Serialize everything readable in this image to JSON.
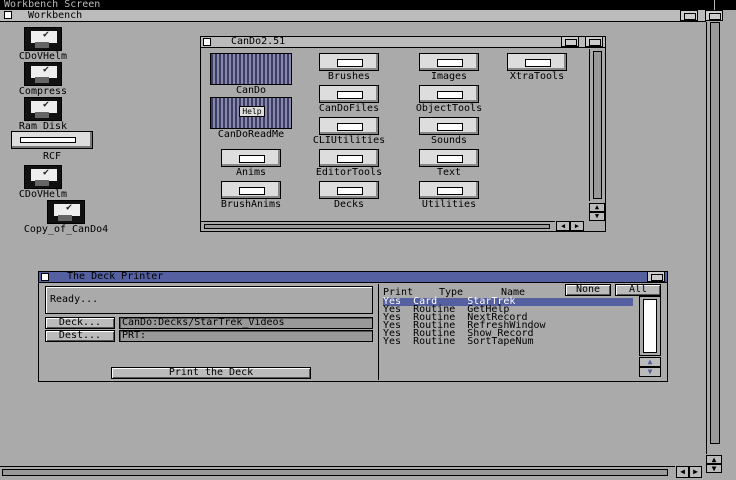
{
  "screen": {
    "title": "Workbench Screen"
  },
  "workbench": {
    "title": "Workbench"
  },
  "desktop_icons": [
    {
      "label": "CDoVHelm"
    },
    {
      "label": "Compress"
    },
    {
      "label": "Ram Disk"
    },
    {
      "label": "RCF"
    },
    {
      "label": "CDoVHelm"
    },
    {
      "label": "Copy_of_CanDo4"
    }
  ],
  "cando_window": {
    "title": "CanDo2.51",
    "icons": [
      {
        "label": "CanDo"
      },
      {
        "label": "Brushes"
      },
      {
        "label": "Images"
      },
      {
        "label": "XtraTools"
      },
      {
        "label": "CanDoFiles"
      },
      {
        "label": "ObjectTools"
      },
      {
        "label": "CanDoReadMe"
      },
      {
        "label": "CLIUtilities"
      },
      {
        "label": "Sounds"
      },
      {
        "label": "Anims"
      },
      {
        "label": "EditorTools"
      },
      {
        "label": "Text"
      },
      {
        "label": "BrushAnims"
      },
      {
        "label": "Decks"
      },
      {
        "label": "Utilities"
      }
    ],
    "readme_overlay": "Help"
  },
  "deck_printer": {
    "title": "The Deck Printer",
    "status": "Ready...",
    "deck_button": "Deck...",
    "deck_path": "CanDo:Decks/StarTrek_Videos",
    "dest_button": "Dest...",
    "dest_path": "PRT:",
    "print_button": "Print the Deck",
    "list_headers": {
      "print": "Print",
      "type": "Type",
      "name": "Name"
    },
    "none_button": "None",
    "all_button": "All",
    "rows": [
      {
        "text": "Yes  Card     StarTrek"
      },
      {
        "text": "Yes  Routine  GetHelp"
      },
      {
        "text": "Yes  Routine  NextRecord"
      },
      {
        "text": "Yes  Routine  RefreshWindow"
      },
      {
        "text": "Yes  Routine  Show Record"
      },
      {
        "text": "Yes  Routine  SortTapeNum"
      }
    ],
    "selected_row": 0
  }
}
